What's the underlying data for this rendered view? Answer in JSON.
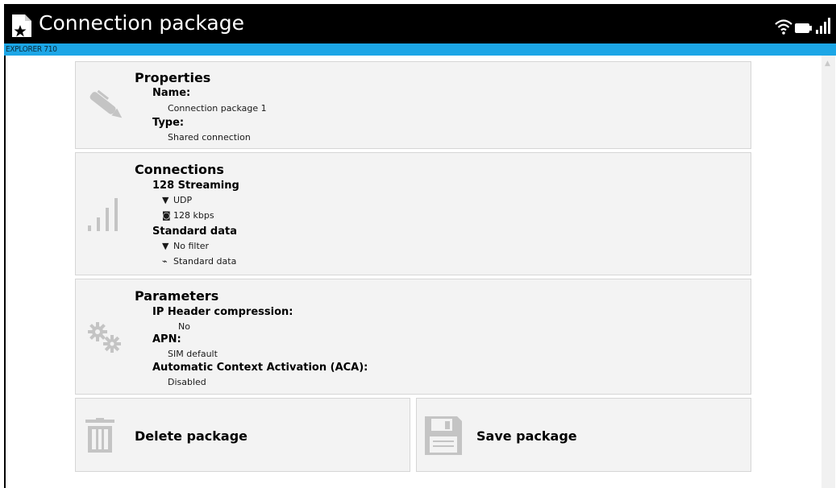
{
  "window": {
    "title": "Connection package",
    "subtitle": "EXPLORER 710"
  },
  "status_icons": [
    "wifi-icon",
    "battery-icon",
    "signal-icon"
  ],
  "properties": {
    "title": "Properties",
    "name_label": "Name:",
    "name_value": "Connection package 1",
    "type_label": "Type:",
    "type_value": "Shared connection"
  },
  "connections": {
    "title": "Connections",
    "items": [
      {
        "name": "128 Streaming",
        "filter": "UDP",
        "rate": "128 kbps"
      },
      {
        "name": "Standard data",
        "filter": "No filter",
        "rate": "Standard data"
      }
    ]
  },
  "parameters": {
    "title": "Parameters",
    "ip_header_label": "IP Header compression:",
    "ip_header_value": "No",
    "apn_label": "APN:",
    "apn_value": "SIM default",
    "aca_label": "Automatic Context Activation (ACA):",
    "aca_value": "Disabled"
  },
  "actions": {
    "delete_label": "Delete package",
    "save_label": "Save package"
  },
  "colors": {
    "title_bar": "#000000",
    "accent_bar": "#1ca6e6",
    "card_bg": "#f3f3f3",
    "icon_gray": "#c4c4c4"
  }
}
